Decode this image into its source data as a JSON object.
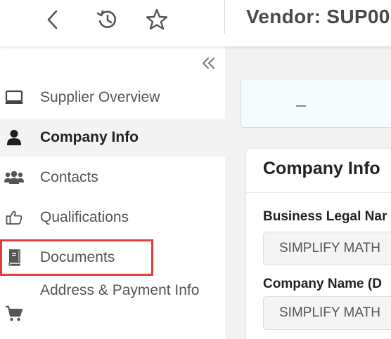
{
  "header": {
    "title": "Vendor: SUP00",
    "back_icon": "chevron-left-icon",
    "history_icon": "history-icon",
    "favorite_icon": "star-outline-icon"
  },
  "sidebar": {
    "collapse_icon": "double-chevron-left-icon",
    "items": [
      {
        "label": "Supplier Overview",
        "icon": "monitor-icon",
        "active": false
      },
      {
        "label": "Company Info",
        "icon": "user-icon",
        "active": true
      },
      {
        "label": "Contacts",
        "icon": "users-icon",
        "active": false
      },
      {
        "label": "Qualifications",
        "icon": "thumbs-up-icon",
        "active": false
      },
      {
        "label": "Documents",
        "icon": "book-icon",
        "active": false,
        "highlighted": true
      },
      {
        "label": "Address & Payment Info",
        "icon": "cart-icon",
        "active": false
      }
    ],
    "highlight_color": "#e53c3c"
  },
  "main": {
    "card": {
      "title": "Company Info",
      "fields": [
        {
          "label": "Business Legal Nar",
          "value": "SIMPLIFY MATH"
        },
        {
          "label": "Company Name (D",
          "value": "SIMPLIFY MATH"
        }
      ]
    }
  }
}
